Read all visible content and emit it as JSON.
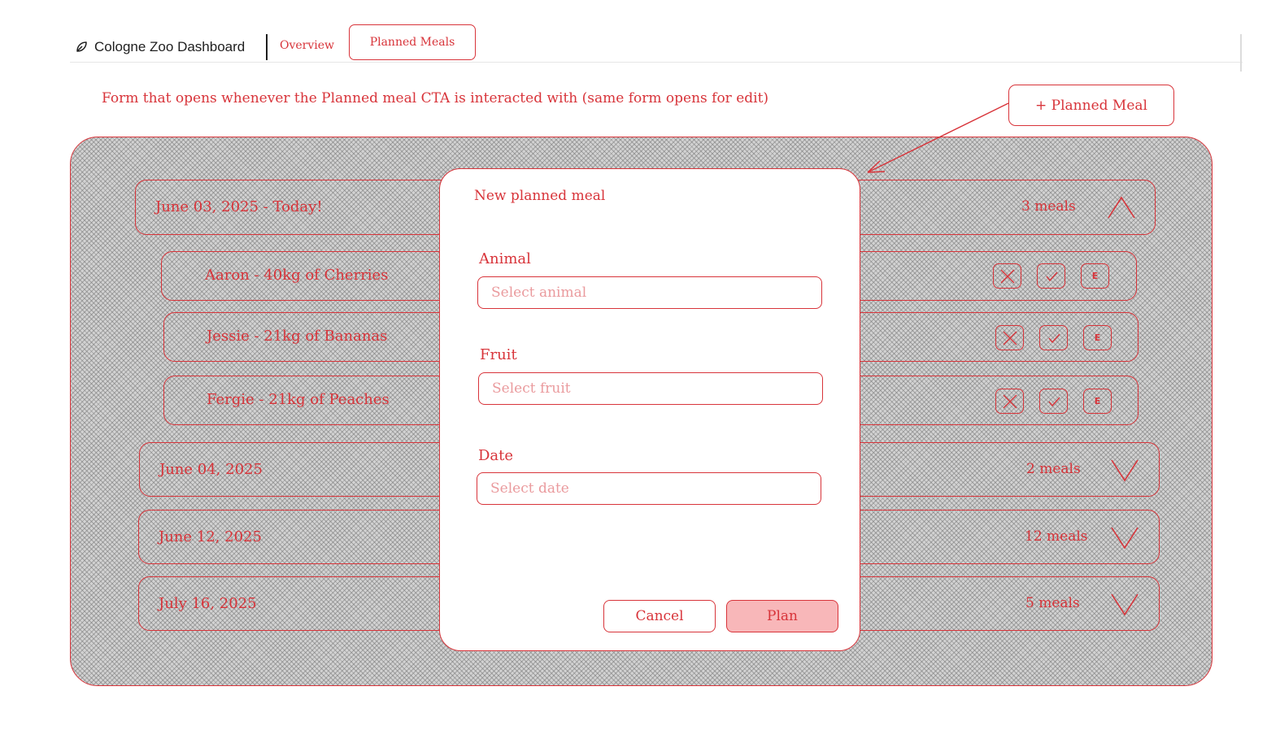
{
  "nav": {
    "brand": "Cologne Zoo Dashboard",
    "tabs": [
      {
        "label": "Overview",
        "active": false
      },
      {
        "label": "Planned Meals",
        "active": true
      }
    ]
  },
  "annotation": "Form that opens whenever the Planned meal CTA is interacted with (same form opens for edit)",
  "cta_label": "+ Planned Meal",
  "days": [
    {
      "date": "June 03, 2025 - Today!",
      "count": "3 meals",
      "expanded": true
    },
    {
      "date": "June 04, 2025",
      "count": "2 meals",
      "expanded": false
    },
    {
      "date": "June 12, 2025",
      "count": "12 meals",
      "expanded": false
    },
    {
      "date": "July 16, 2025",
      "count": "5 meals",
      "expanded": false
    }
  ],
  "meals": [
    {
      "label": "Aaron - 40kg of Cherries",
      "edit_letter": "E"
    },
    {
      "label": "Jessie - 21kg of Bananas",
      "edit_letter": "E"
    },
    {
      "label": "Fergie - 21kg of Peaches",
      "edit_letter": "E"
    }
  ],
  "modal": {
    "title": "New planned meal",
    "fields": [
      {
        "label": "Animal",
        "placeholder": "Select animal"
      },
      {
        "label": "Fruit",
        "placeholder": "Select fruit"
      },
      {
        "label": "Date",
        "placeholder": "Select date"
      }
    ],
    "cancel": "Cancel",
    "submit": "Plan"
  },
  "colors": {
    "accent": "#d8343a",
    "primary_fill": "#f8b7b9",
    "hatch_bg": "#d2d2d2"
  }
}
